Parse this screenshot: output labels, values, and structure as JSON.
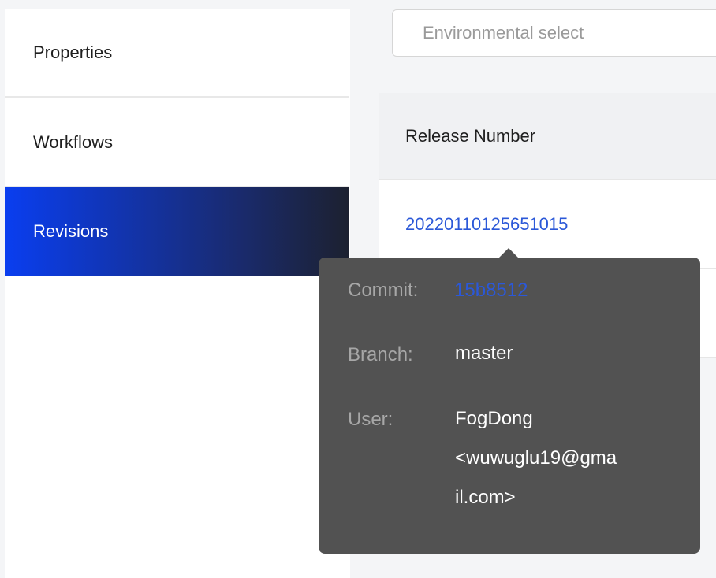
{
  "sidebar": {
    "items": [
      {
        "label": "Properties"
      },
      {
        "label": "Workflows"
      },
      {
        "label": "Revisions"
      }
    ]
  },
  "environment_select": {
    "placeholder": "Environmental select"
  },
  "table": {
    "header": "Release Number",
    "rows": [
      {
        "release_number": "20220110125651015"
      }
    ]
  },
  "tooltip": {
    "commit_label": "Commit:",
    "commit_value": "15b8512",
    "branch_label": "Branch:",
    "branch_value": "master",
    "user_label": "User:",
    "user_value_line1": "FogDong",
    "user_value_line2": "<wuwuglu19@gma",
    "user_value_line3": "il.com>"
  },
  "colors": {
    "active_gradient_start": "#0a3ef0",
    "active_gradient_end": "#1c2130",
    "link": "#2b58d8",
    "tooltip_bg": "#525252"
  }
}
